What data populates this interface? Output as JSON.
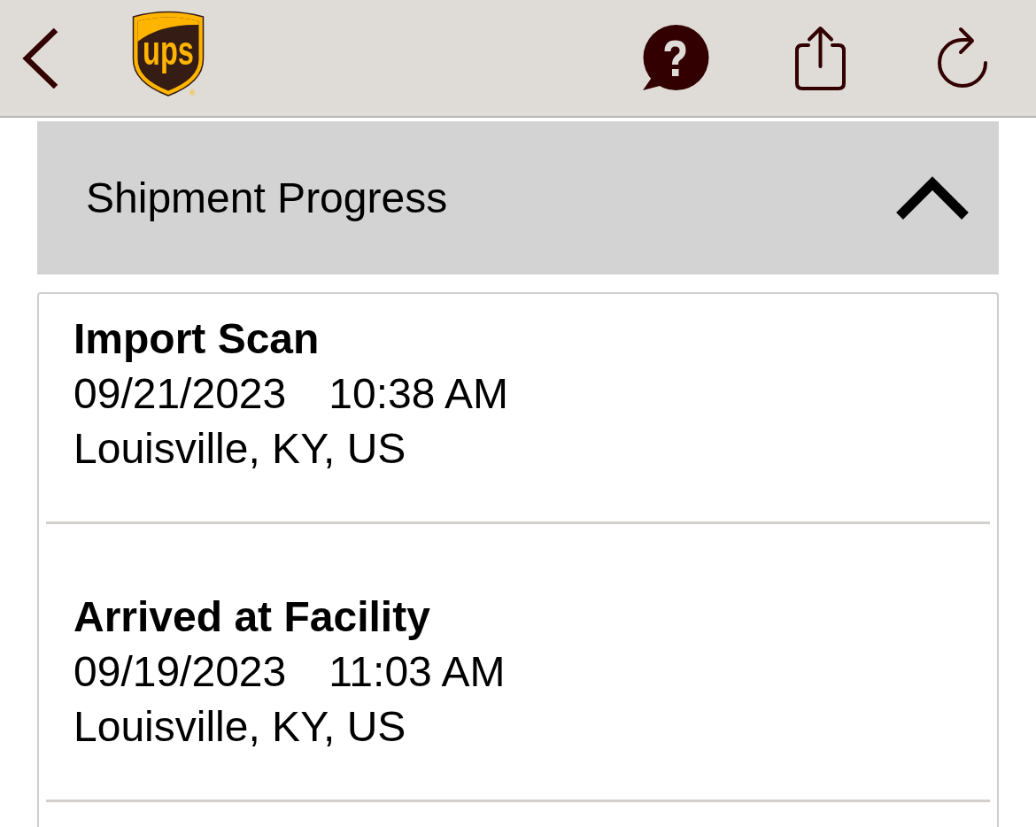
{
  "top_bar": {
    "logo_text": "ups",
    "logo_mark": "®"
  },
  "section": {
    "title": "Shipment Progress",
    "expanded": true
  },
  "events": [
    {
      "title": "Import Scan",
      "date": "09/21/2023",
      "time": "10:38 AM",
      "location": "Louisville, KY, US"
    },
    {
      "title": "Arrived at Facility",
      "date": "09/19/2023",
      "time": "11:03 AM",
      "location": "Louisville, KY, US"
    }
  ]
}
